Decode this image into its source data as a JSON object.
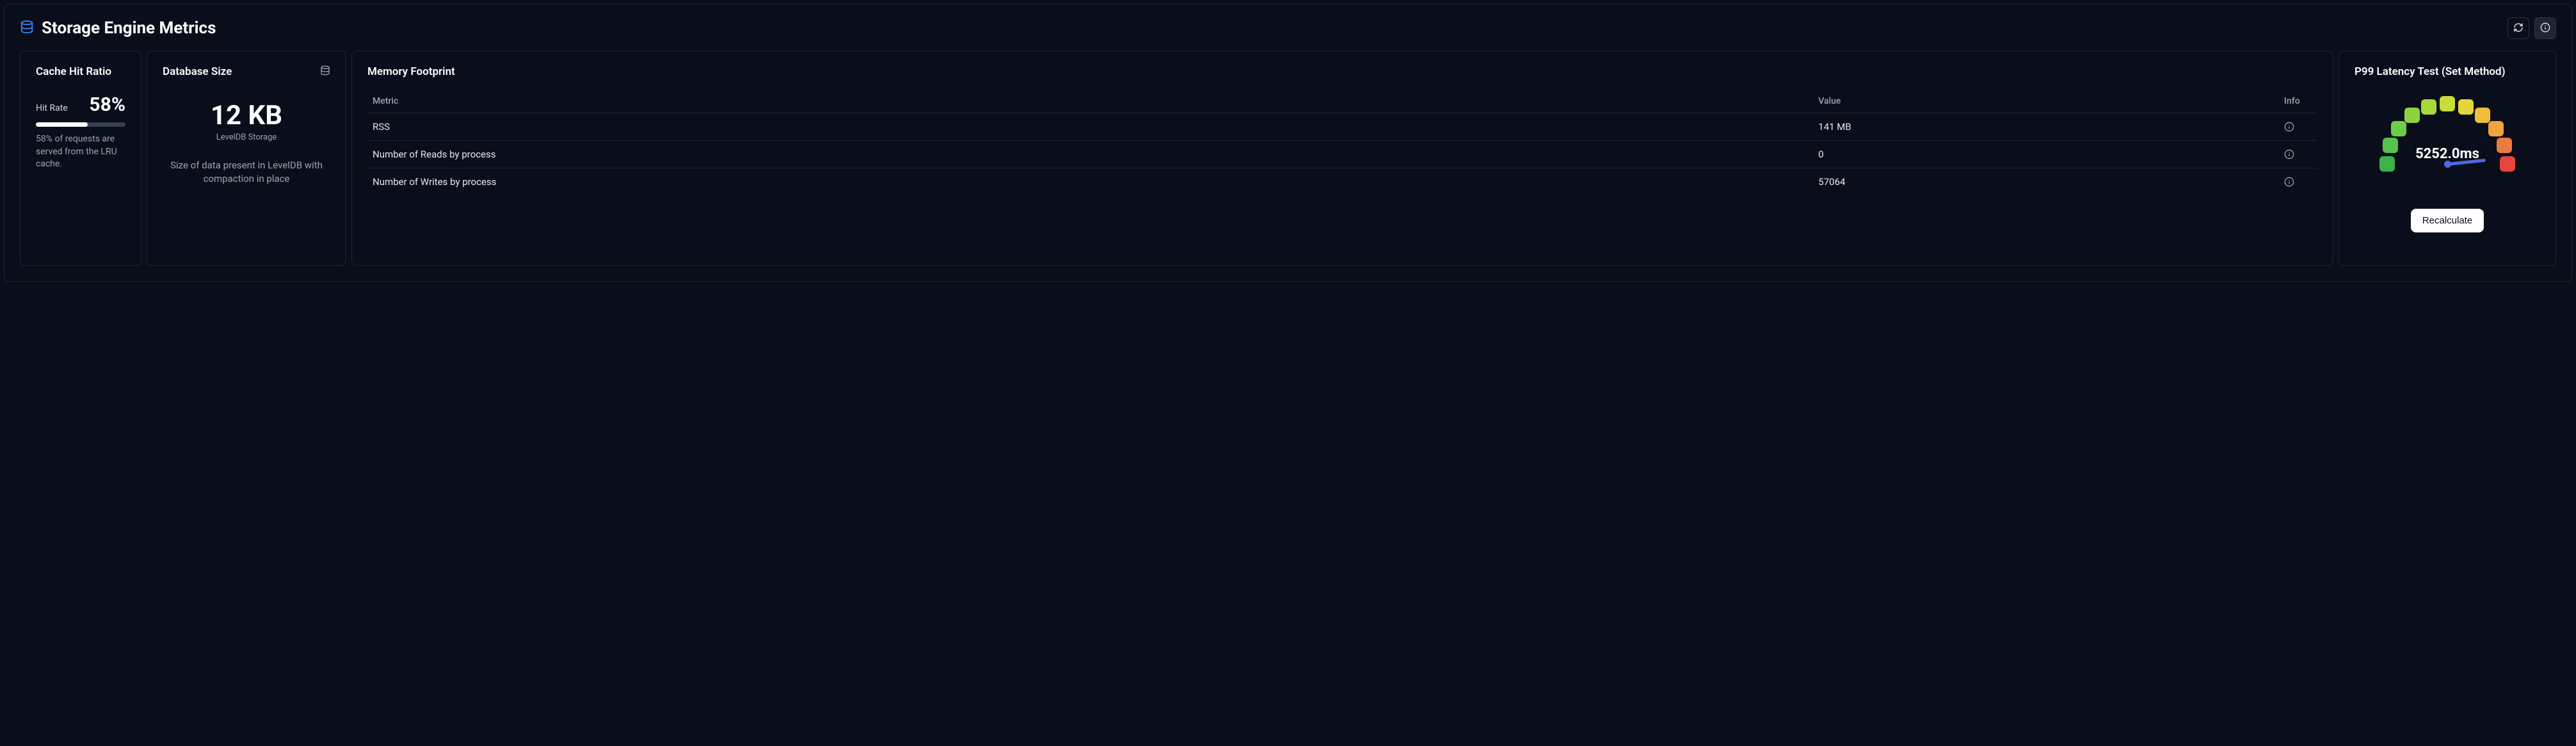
{
  "header": {
    "title": "Storage Engine Metrics"
  },
  "cache": {
    "title": "Cache Hit Ratio",
    "label": "Hit Rate",
    "value": "58%",
    "progress_percent": 58,
    "description": "58% of requests are served from the LRU cache."
  },
  "dbsize": {
    "title": "Database Size",
    "value": "12 KB",
    "subtitle": "LevelDB Storage",
    "description": "Size of data present in LevelDB with compaction in place"
  },
  "memory": {
    "title": "Memory Footprint",
    "columns": [
      "Metric",
      "Value",
      "Info"
    ],
    "rows": [
      {
        "metric": "RSS",
        "value": "141 MB"
      },
      {
        "metric": "Number of Reads by process",
        "value": "0"
      },
      {
        "metric": "Number of Writes by process",
        "value": "57064"
      }
    ]
  },
  "latency": {
    "title": "P99 Latency Test (Set Method)",
    "value": "5252.0ms",
    "button": "Recalculate",
    "segments": [
      "#3eb24a",
      "#56c24a",
      "#6fce45",
      "#8ad33f",
      "#a8d93a",
      "#c9dc38",
      "#e6d53a",
      "#efbf3c",
      "#f0a33e",
      "#ec7b3f",
      "#e8433f"
    ]
  }
}
